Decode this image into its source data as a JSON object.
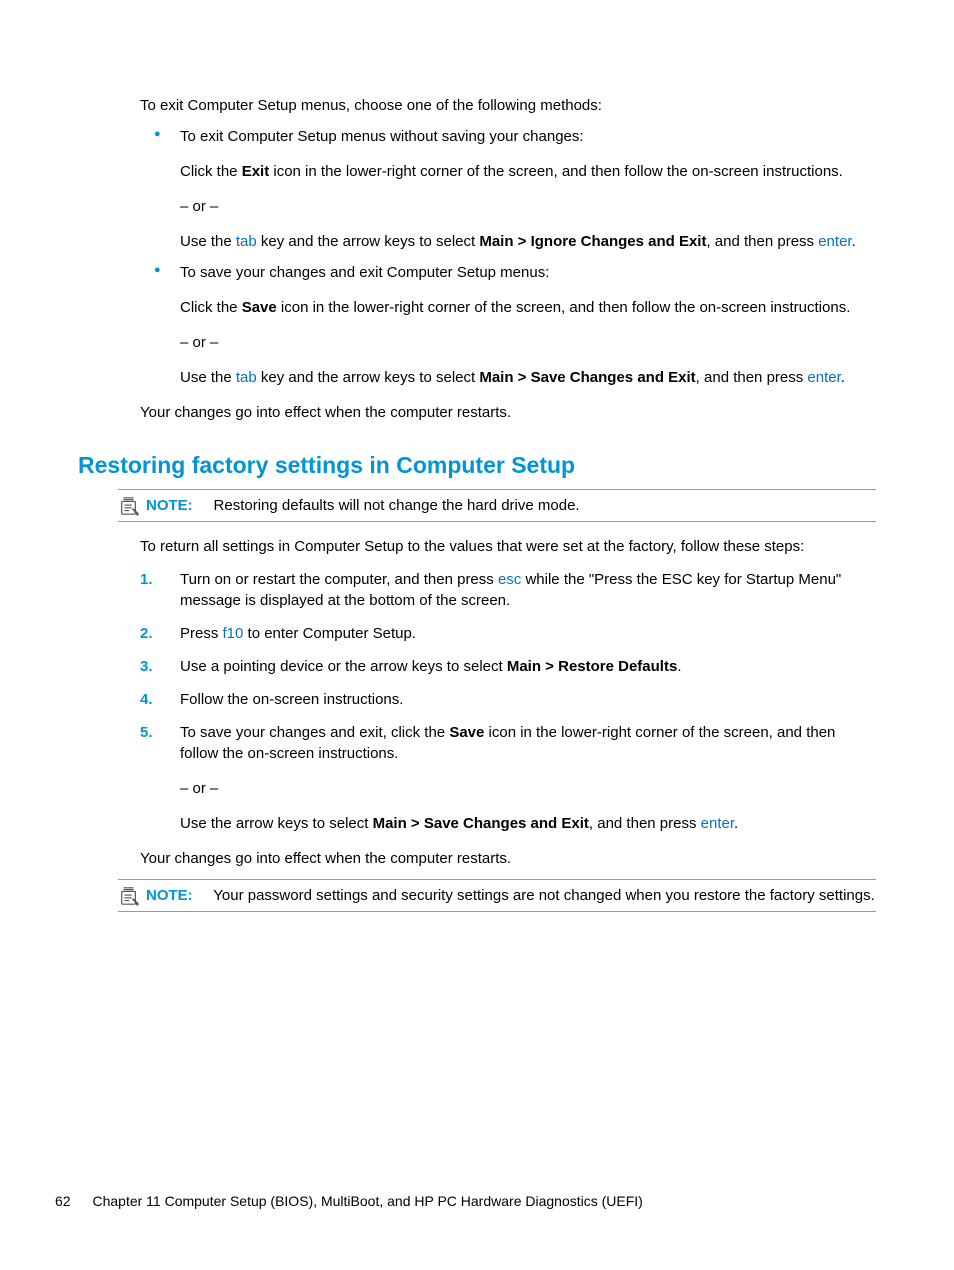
{
  "intro": "To exit Computer Setup menus, choose one of the following methods:",
  "bullets": [
    {
      "lead": "To exit Computer Setup menus without saving your changes:",
      "click_pre": "Click the ",
      "click_bold": "Exit",
      "click_post": " icon in the lower-right corner of the screen, and then follow the on-screen instructions.",
      "or": "– or –",
      "use_pre": "Use the ",
      "key1": "tab",
      "use_mid": " key and the arrow keys to select ",
      "use_bold": "Main > Ignore Changes and Exit",
      "use_post": ", and then press ",
      "key2": "enter",
      "use_end": "."
    },
    {
      "lead": "To save your changes and exit Computer Setup menus:",
      "click_pre": "Click the ",
      "click_bold": "Save",
      "click_post": " icon in the lower-right corner of the screen, and then follow the on-screen instructions.",
      "or": "– or –",
      "use_pre": "Use the ",
      "key1": "tab",
      "use_mid": " key and the arrow keys to select ",
      "use_bold": "Main > Save Changes and Exit",
      "use_post": ", and then press ",
      "key2": "enter",
      "use_end": "."
    }
  ],
  "after_bullets": "Your changes go into effect when the computer restarts.",
  "heading": "Restoring factory settings in Computer Setup",
  "note1": {
    "label": "NOTE:",
    "text": "Restoring defaults will not change the hard drive mode."
  },
  "intro2": "To return all settings in Computer Setup to the values that were set at the factory, follow these steps:",
  "steps": [
    {
      "num": "1.",
      "pre": "Turn on or restart the computer, and then press ",
      "key": "esc",
      "post": " while the \"Press the ESC key for Startup Menu\" message is displayed at the bottom of the screen."
    },
    {
      "num": "2.",
      "pre": "Press ",
      "key": "f10",
      "post": " to enter Computer Setup."
    },
    {
      "num": "3.",
      "pre": "Use a pointing device or the arrow keys to select ",
      "bold": "Main > Restore Defaults",
      "post": "."
    },
    {
      "num": "4.",
      "text": "Follow the on-screen instructions."
    },
    {
      "num": "5.",
      "pre": "To save your changes and exit, click the ",
      "bold": "Save",
      "post": " icon in the lower-right corner of the screen, and then follow the on-screen instructions.",
      "or": "– or –",
      "alt_pre": "Use the arrow keys to select ",
      "alt_bold": "Main > Save Changes and Exit",
      "alt_mid": ", and then press ",
      "alt_key": "enter",
      "alt_end": "."
    }
  ],
  "after_steps": "Your changes go into effect when the computer restarts.",
  "note2": {
    "label": "NOTE:",
    "text": "Your password settings and security settings are not changed when you restore the factory settings."
  },
  "footer": {
    "page": "62",
    "chapter": "Chapter 11   Computer Setup (BIOS), MultiBoot, and HP PC Hardware Diagnostics (UEFI)"
  }
}
